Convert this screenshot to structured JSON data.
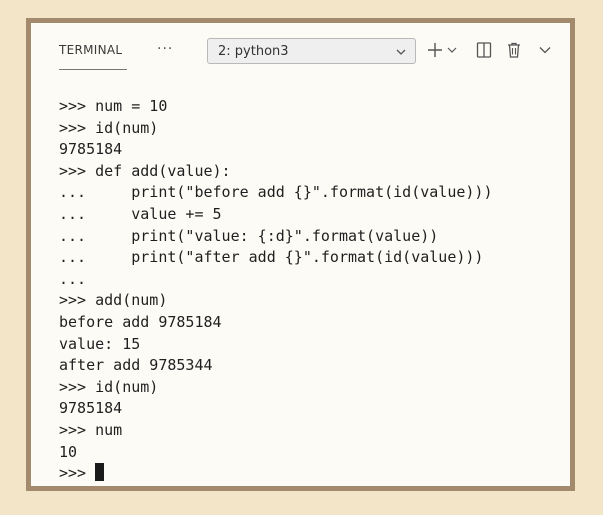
{
  "panel": {
    "tab_label": "TERMINAL",
    "more_label": "···",
    "terminal_select": "2: python3"
  },
  "icons": {
    "more": "ellipsis-icon",
    "select_chevron": "chevron-down-icon",
    "new_terminal": "plus-icon",
    "new_terminal_menu": "chevron-down-icon",
    "split": "split-icon",
    "kill": "trash-icon",
    "collapse": "chevron-down-icon"
  },
  "terminal": {
    "lines": [
      ">>> num = 10",
      ">>> id(num)",
      "9785184",
      ">>> def add(value):",
      "...     print(\"before add {}\".format(id(value)))",
      "...     value += 5",
      "...     print(\"value: {:d}\".format(value))",
      "...     print(\"after add {}\".format(id(value)))",
      "...",
      ">>> add(num)",
      "before add 9785184",
      "value: 15",
      "after add 9785344",
      ">>> id(num)",
      "9785184",
      ">>> num",
      "10"
    ],
    "prompt": ">>> "
  }
}
